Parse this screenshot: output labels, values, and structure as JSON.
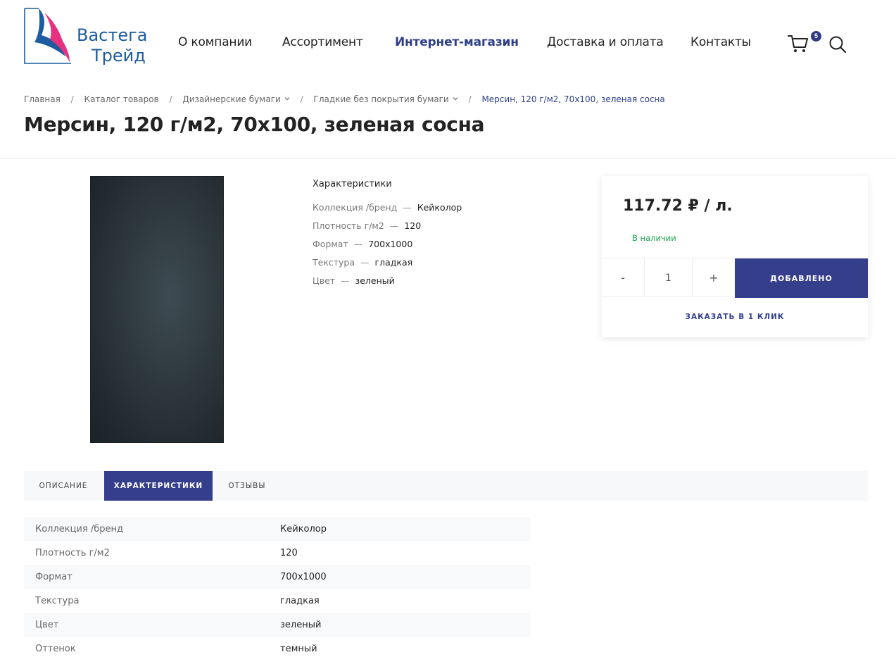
{
  "brand": {
    "name_line1": "Вастега",
    "name_line2": "Трейд",
    "colors": {
      "blue": "#1d5c9e",
      "pink": "#e5317e",
      "dark_blue": "#2f3a82"
    }
  },
  "nav": {
    "items": [
      {
        "label": "О компании",
        "active": false
      },
      {
        "label": "Ассортимент",
        "active": false
      },
      {
        "label": "Интернет-магазин",
        "active": true
      },
      {
        "label": "Доставка и оплата",
        "active": false
      },
      {
        "label": "Контакты",
        "active": false
      }
    ],
    "cart_count": "5",
    "cart_icon": "shopping-cart-icon",
    "search_icon": "search-icon"
  },
  "breadcrumbs": {
    "items": [
      {
        "label": "Главная"
      },
      {
        "label": "Каталог товаров"
      },
      {
        "label": "Дизайнерские бумаги",
        "dropdown": true
      },
      {
        "label": "Гладкие без покрытия бумаги",
        "dropdown": true
      },
      {
        "label": "Мерсин, 120 г/м2, 70x100, зеленая сосна",
        "current": true
      }
    ],
    "separator": "/"
  },
  "product": {
    "title": "Мерсин, 120 г/м2, 70x100, зеленая сосна",
    "image_color": "#2f3a40"
  },
  "characteristics_short": {
    "heading": "Характеристики",
    "separator": "—",
    "rows": [
      {
        "key": "Коллекция /бренд",
        "value": "Кейколор"
      },
      {
        "key": "Плотность г/м2",
        "value": "120"
      },
      {
        "key": "Формат",
        "value": "700x1000"
      },
      {
        "key": "Текстура",
        "value": "гладкая"
      },
      {
        "key": "Цвет",
        "value": "зеленый"
      }
    ]
  },
  "buybox": {
    "price": "117.72 ₽ / л.",
    "stock": "В наличии",
    "qty_minus": "-",
    "qty_value": "1",
    "qty_plus": "+",
    "add_label": "ДОБАВЛЕНО",
    "one_click_label": "ЗАКАЗАТЬ В 1 КЛИК",
    "colors": {
      "button": "#353e8a",
      "stock": "#1aa34a"
    }
  },
  "tabs": [
    {
      "label": "ОПИСАНИЕ",
      "active": false
    },
    {
      "label": "ХАРАКТЕРИСТИКИ",
      "active": true
    },
    {
      "label": "ОТЗЫВЫ",
      "active": false
    }
  ],
  "spec_table": [
    {
      "key": "Коллекция /бренд",
      "value": "Кейколор"
    },
    {
      "key": "Плотность г/м2",
      "value": "120"
    },
    {
      "key": "Формат",
      "value": "700x1000"
    },
    {
      "key": "Текстура",
      "value": "гладкая"
    },
    {
      "key": "Цвет",
      "value": "зеленый"
    },
    {
      "key": "Оттенок",
      "value": "темный"
    }
  ]
}
